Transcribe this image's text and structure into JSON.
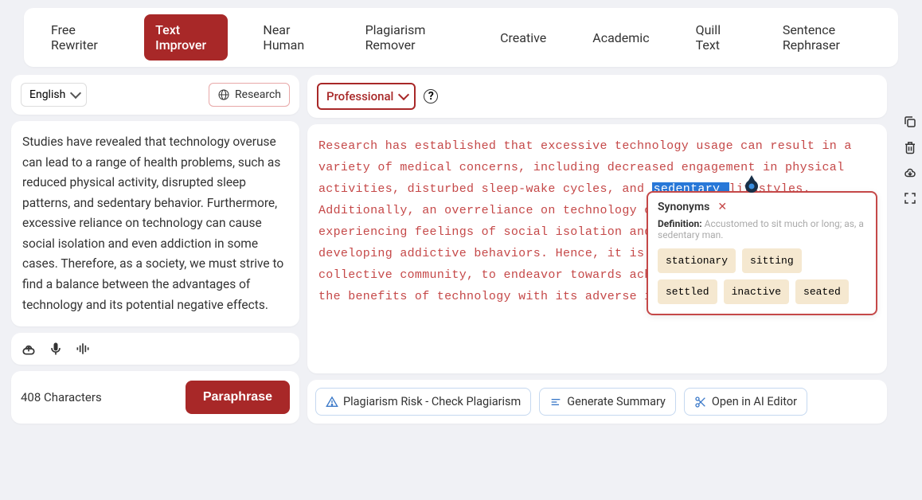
{
  "tabs": [
    {
      "label": "Free Rewriter",
      "active": false
    },
    {
      "label": "Text Improver",
      "active": true
    },
    {
      "label": "Near Human",
      "active": false
    },
    {
      "label": "Plagiarism Remover",
      "active": false
    },
    {
      "label": "Creative",
      "active": false
    },
    {
      "label": "Academic",
      "active": false
    },
    {
      "label": "Quill Text",
      "active": false
    },
    {
      "label": "Sentence Rephraser",
      "active": false
    }
  ],
  "left": {
    "lang": "English",
    "research_label": "Research",
    "text": "Studies have revealed that technology overuse can lead to a range of health problems, such as reduced physical activity, disrupted sleep patterns, and sedentary behavior. Furthermore, excessive reliance on technology can cause social isolation and even addiction in some cases. Therefore, as a society, we must strive to find a balance between the advantages of technology and its potential negative effects.",
    "char_count": "408 Characters",
    "paraphrase_btn": "Paraphrase"
  },
  "right": {
    "tone": "Professional",
    "text_pre": "Research has established that excessive technology usage can result in a variety of medical concerns, including decreased engagement in physical activities, disturbed sleep-wake cycles, and ",
    "highlight": "sedentary ",
    "text_post": "lifestyles. Additionally, an overreliance on technology can lead to individuals experiencing feelings of social isolation and, in some instances, developing addictive behaviors. Hence, it is incumbent upon us, as a collective community, to endeavor towards achieving a equilibrium between the benefits of technology with its adverse impacts.",
    "footer": {
      "plagiarism": "Plagiarism Risk - Check Plagiarism",
      "summary": "Generate Summary",
      "ai_editor": "Open in AI Editor"
    }
  },
  "synonyms": {
    "title": "Synonyms",
    "def_label": "Definition:",
    "def_text": "Accustomed to sit much or long; as, a sedentary man.",
    "chips": [
      "stationary",
      "sitting",
      "settled",
      "inactive",
      "seated"
    ]
  }
}
